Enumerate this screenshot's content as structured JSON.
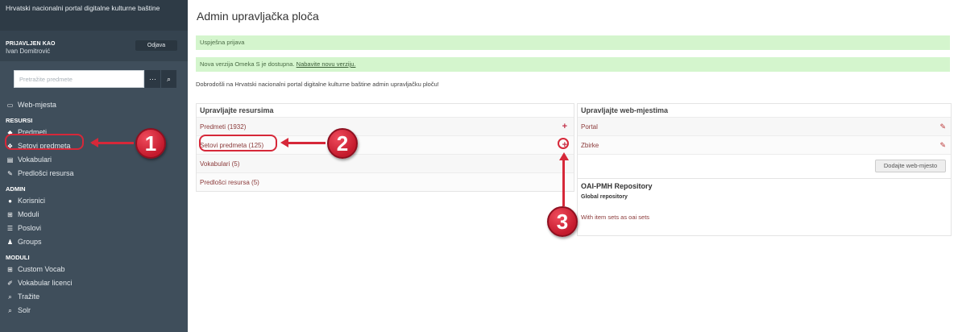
{
  "sidebar": {
    "site_title": "Hrvatski nacionalni portal digitalne kulturne baštine",
    "login_label": "PRIJAVLJEN KAO",
    "user_name": "Ivan Domitrović",
    "logout_label": "Odjava",
    "search_placeholder": "Pretražite predmete",
    "top_item": {
      "label": "Web-mjesta",
      "icon": "monitor-icon"
    },
    "section_resursi": "RESURSI",
    "resursi": [
      {
        "label": "Predmeti",
        "icon": "cube-icon"
      },
      {
        "label": "Setovi predmeta",
        "icon": "cubes-icon"
      },
      {
        "label": "Vokabulari",
        "icon": "book-icon"
      },
      {
        "label": "Predlošci resursa",
        "icon": "pencil-icon"
      }
    ],
    "section_admin": "ADMIN",
    "admin": [
      {
        "label": "Korisnici",
        "icon": "user-icon"
      },
      {
        "label": "Moduli",
        "icon": "plus-square-icon"
      },
      {
        "label": "Poslovi",
        "icon": "list-icon"
      },
      {
        "label": "Groups",
        "icon": "users-icon"
      }
    ],
    "section_moduli": "MODULI",
    "moduli": [
      {
        "label": "Custom Vocab",
        "icon": "plus-square-icon"
      },
      {
        "label": "Vokabular licenci",
        "icon": "wrench-icon"
      },
      {
        "label": "Tražite",
        "icon": "search-icon"
      },
      {
        "label": "Solr",
        "icon": "search-icon"
      }
    ]
  },
  "main": {
    "page_title": "Admin upravljačka ploča",
    "alert_success": "Uspješna prijava",
    "alert_version_text": "Nova verzija Omeka S je dostupna.",
    "alert_version_link": "Nabavite novu verziju.",
    "welcome": "Dobrodošli na Hrvatski nacionalni portal digitalne kulturne baštine admin upravljačku ploču!",
    "resources_title": "Upravljajte resursima",
    "resources": [
      {
        "label": "Predmeti (1932)",
        "action": "+"
      },
      {
        "label": "Setovi predmeta (125)",
        "action": "+"
      },
      {
        "label": "Vokabulari (5)",
        "action": ""
      },
      {
        "label": "Predlošci resursa (5)",
        "action": ""
      }
    ],
    "sites_title": "Upravljajte web-mjestima",
    "sites": [
      {
        "label": "Portal"
      },
      {
        "label": "Zbirke"
      }
    ],
    "add_site_label": "Dodajte web-mjesto",
    "oai_title": "OAI-PMH Repository",
    "oai_sub": "Global repository",
    "oai_item": "With item sets as oai sets"
  },
  "annotations": {
    "badge_1": "1",
    "badge_2": "2",
    "badge_3": "3",
    "accent_color": "#d62839"
  }
}
